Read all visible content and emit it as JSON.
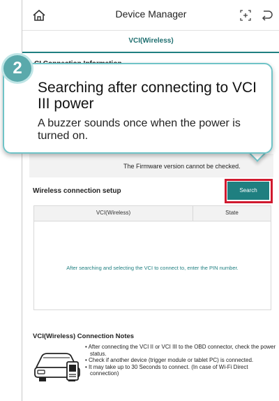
{
  "header": {
    "title": "Device Manager",
    "tab_label": "VCI(Wireless)"
  },
  "connection_info": {
    "section_title": "VCI Connection Information",
    "section_title_visible": "CI Connection Information",
    "firmware_message": "The Firmware version cannot be checked."
  },
  "callout": {
    "step_number": "2",
    "headline": "Searching after connecting to VCI III power",
    "subtext": "A buzzer sounds once when the power is turned on."
  },
  "wireless": {
    "section_title": "Wireless connection setup",
    "search_label": "Search",
    "columns": [
      "VCI(Wireless)",
      "State"
    ],
    "empty_message": "After searching and selecting the VCI to connect to, enter the PIN number."
  },
  "notes": {
    "title": "VCI(Wireless) Connection Notes",
    "items": [
      "• After connecting the VCI II or VCI III to the OBD connector, check the power status.",
      "• Check if another device (trigger module or tablet PC) is connected.",
      "• It may take up to 30 Seconds to connect. (In case of Wi-Fi Direct connection)"
    ]
  },
  "colors": {
    "accent": "#1f7f80",
    "highlight": "#d0192e",
    "callout_border": "#6fc3c7"
  },
  "icons": [
    "home-icon",
    "vci-plus-icon",
    "back-icon",
    "car-vci-illustration"
  ]
}
